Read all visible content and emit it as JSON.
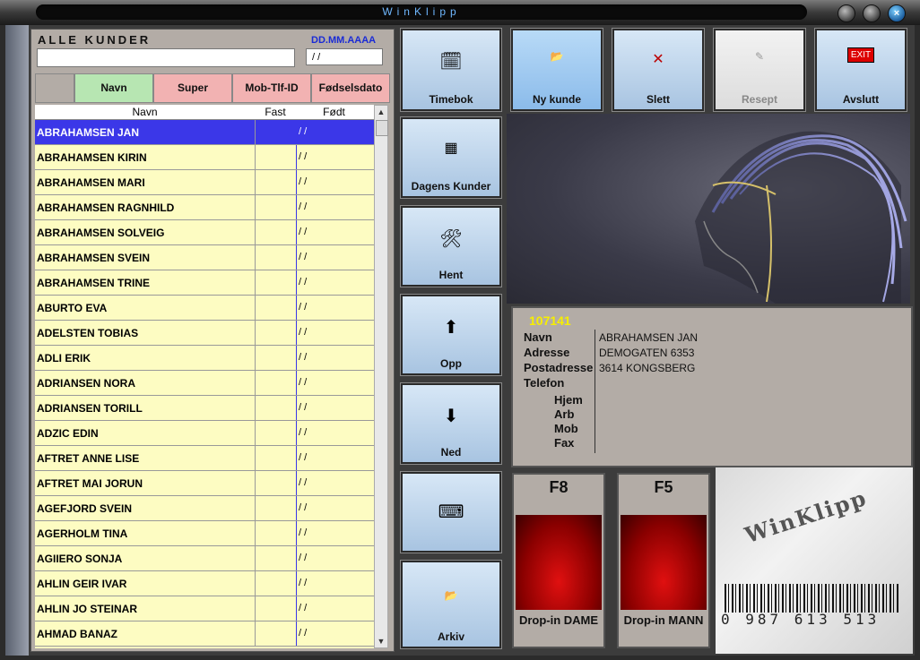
{
  "app": {
    "title": "WinKlipp"
  },
  "list": {
    "title": "ALLE KUNDER",
    "date_format_hint": "DD.MM.AAAA",
    "search_value": "",
    "date_value": "/ /",
    "sort_buttons": [
      "Navn",
      "Super",
      "Mob-Tlf-ID",
      "Fødselsdato"
    ],
    "columns": [
      "Navn",
      "Fast",
      "Født"
    ],
    "rows": [
      {
        "name": "ABRAHAMSEN JAN",
        "born": "/ /"
      },
      {
        "name": "ABRAHAMSEN KIRIN",
        "born": "/ /"
      },
      {
        "name": "ABRAHAMSEN MARI",
        "born": "/ /"
      },
      {
        "name": "ABRAHAMSEN RAGNHILD",
        "born": "/ /"
      },
      {
        "name": "ABRAHAMSEN SOLVEIG",
        "born": "/ /"
      },
      {
        "name": "ABRAHAMSEN SVEIN",
        "born": "/ /"
      },
      {
        "name": "ABRAHAMSEN TRINE",
        "born": "/ /"
      },
      {
        "name": "ABURTO EVA",
        "born": "/ /"
      },
      {
        "name": "ADELSTEN TOBIAS",
        "born": "/ /"
      },
      {
        "name": "ADLI ERIK",
        "born": "/ /"
      },
      {
        "name": "ADRIANSEN NORA",
        "born": "/ /"
      },
      {
        "name": "ADRIANSEN TORILL",
        "born": "/ /"
      },
      {
        "name": "ADZIC EDIN",
        "born": "/ /"
      },
      {
        "name": "AFTRET ANNE LISE",
        "born": "/ /"
      },
      {
        "name": "AFTRET MAI JORUN",
        "born": "/ /"
      },
      {
        "name": "AGEFJORD SVEIN",
        "born": "/ /"
      },
      {
        "name": "AGERHOLM TINA",
        "born": "/ /"
      },
      {
        "name": "AGIIERO SONJA",
        "born": "/ /"
      },
      {
        "name": "AHLIN GEIR IVAR",
        "born": "/ /"
      },
      {
        "name": "AHLIN JO STEINAR",
        "born": "/ /"
      },
      {
        "name": "AHMAD BANAZ",
        "born": "/ /"
      }
    ]
  },
  "toolbar": {
    "timebok": "Timebok",
    "ny_kunde": "Ny kunde",
    "slett": "Slett",
    "resept": "Resept",
    "avslutt": "Avslutt"
  },
  "side_buttons": {
    "dagens_kunder": "Dagens Kunder",
    "hent": "Hent",
    "opp": "Opp",
    "ned": "Ned",
    "arkiv": "Arkiv"
  },
  "customer": {
    "id": "107141",
    "labels": {
      "navn": "Navn",
      "adresse": "Adresse",
      "postadresse": "Postadresse",
      "telefon": "Telefon",
      "hjem": "Hjem",
      "arb": "Arb",
      "mob": "Mob",
      "fax": "Fax"
    },
    "name": "ABRAHAMSEN JAN",
    "address": "DEMOGATEN 6353",
    "postal": "3614 KONGSBERG"
  },
  "dropin": [
    {
      "key": "F8",
      "label": "Drop-in DAME"
    },
    {
      "key": "F5",
      "label": "Drop-in MANN"
    }
  ],
  "logo": {
    "text": "WinKlipp",
    "barcode_number": "0 987 613 513"
  },
  "colors": {
    "list_bg": "#fdfcc2",
    "selected": "#3b37e8",
    "id_yellow": "#f6ee00"
  },
  "icons": {
    "timebok": "clock-calendar-icon",
    "ny_kunde": "folder-icon",
    "slett": "x-icon",
    "resept": "prescription-icon",
    "avslutt": "exit-sign-icon",
    "dagens_kunder": "calendar-grid-icon",
    "hent": "hand-fetch-icon",
    "opp": "arrow-up-icon",
    "ned": "arrow-down-icon",
    "keyboard": "keyboard-icon",
    "arkiv": "folder-open-icon"
  }
}
